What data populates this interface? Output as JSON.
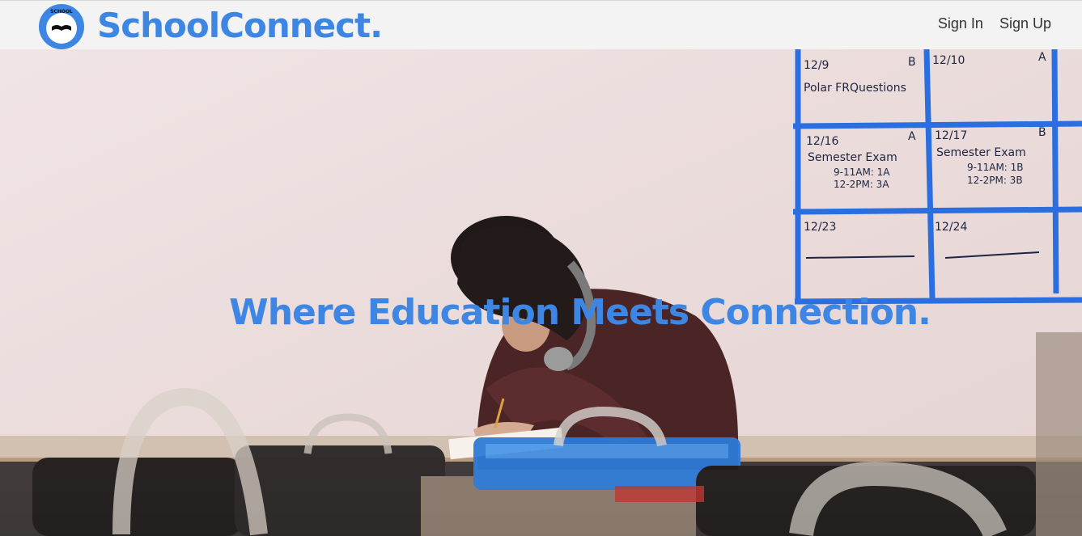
{
  "brand": {
    "name": "SchoolConnect.",
    "logo_text": "SCHOOL CONNECT",
    "color": "#3e86e4"
  },
  "nav": {
    "items": [
      {
        "label": "Sign In"
      },
      {
        "label": "Sign Up"
      }
    ]
  },
  "hero": {
    "tagline": "Where Education Meets Connection.",
    "calendar": {
      "cells": [
        {
          "date": "12/9",
          "letter": "B",
          "lines": [
            "Polar FRQuestions"
          ]
        },
        {
          "date": "12/10",
          "letter": "A",
          "lines": []
        },
        {
          "date": "12/16",
          "letter": "A",
          "lines": [
            "Semester Exam",
            "9-11AM: 1A",
            "12-2PM: 3A"
          ]
        },
        {
          "date": "12/17",
          "letter": "B",
          "lines": [
            "Semester Exam",
            "9-11AM: 1B",
            "12-2PM: 3B"
          ]
        },
        {
          "date": "12/23",
          "letter": "",
          "lines": []
        },
        {
          "date": "12/24",
          "letter": "",
          "lines": []
        }
      ]
    }
  }
}
